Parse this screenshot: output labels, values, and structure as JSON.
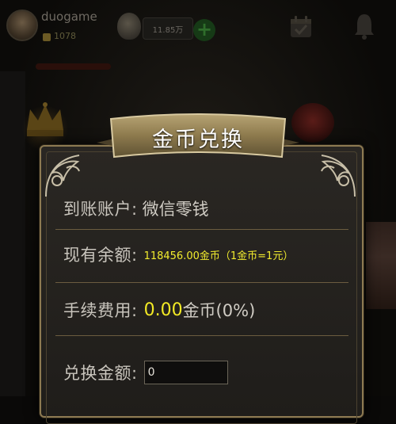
{
  "background": {
    "username": "duogame",
    "coin_amount": "1078",
    "balance_pill": "11.85万"
  },
  "dialog": {
    "title": "金币兑换",
    "account_label": "到账账户:",
    "account_value": "微信零钱",
    "balance_label": "现有余额:",
    "balance_value": "118456.00金币（1金币=1元）",
    "fee_label": "手续费用:",
    "fee_value": "0.00",
    "fee_suffix": "金币(0%)",
    "amount_label": "兑换金额:",
    "amount_input_value": "0"
  },
  "colors": {
    "accent_gold": "#8d7a52",
    "highlight_yellow": "#f3ea25",
    "banner_gold": "#9c8a5e"
  }
}
